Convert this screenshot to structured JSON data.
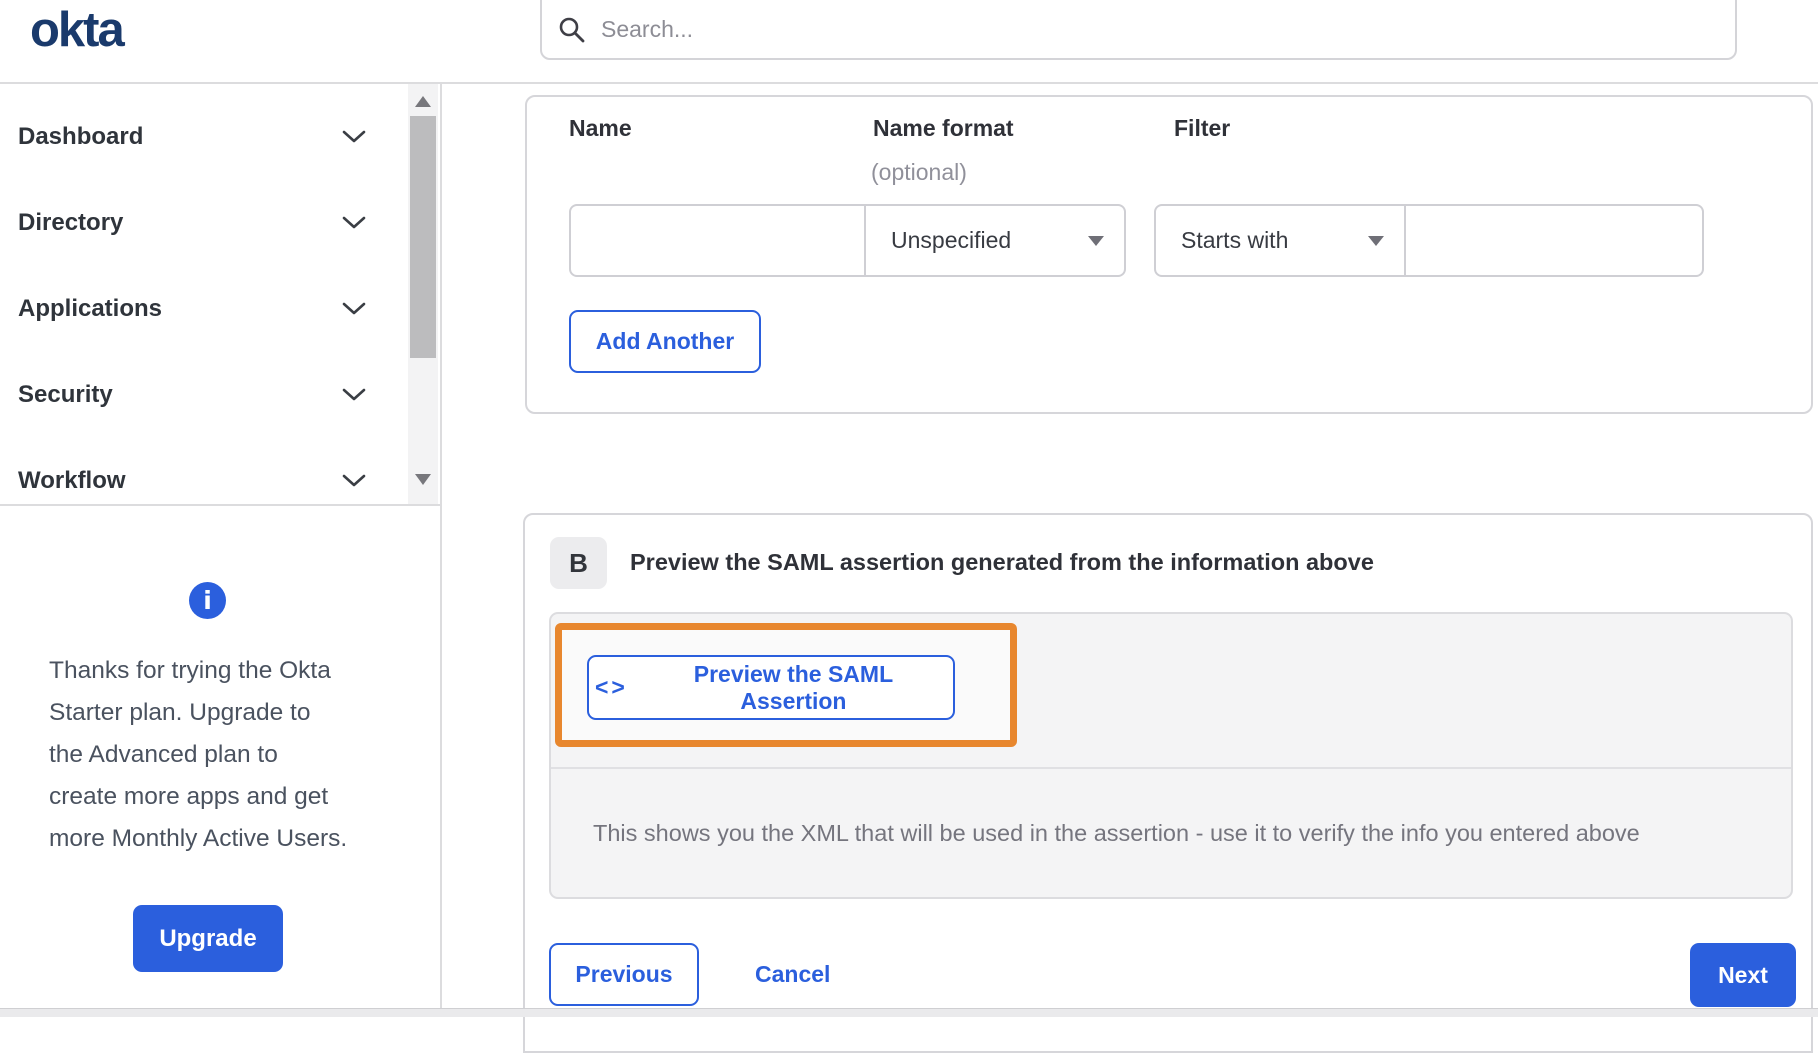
{
  "brand": {
    "logo_text": "okta"
  },
  "header": {
    "search_placeholder": "Search..."
  },
  "sidebar": {
    "items": [
      {
        "label": "Dashboard"
      },
      {
        "label": "Directory"
      },
      {
        "label": "Applications"
      },
      {
        "label": "Security"
      },
      {
        "label": "Workflow"
      }
    ]
  },
  "upgrade_panel": {
    "lines": [
      "Thanks for trying the Okta",
      "Starter plan. Upgrade to",
      "the Advanced plan to",
      "create more apps and get",
      "more Monthly Active Users."
    ],
    "button_label": "Upgrade"
  },
  "attribute_form": {
    "name_label": "Name",
    "name_format_label": "Name format",
    "name_format_sublabel": "(optional)",
    "filter_label": "Filter",
    "name_value": "",
    "name_format_value": "Unspecified",
    "filter_type_value": "Starts with",
    "filter_value": "",
    "add_another_label": "Add Another"
  },
  "preview_section": {
    "badge": "B",
    "heading": "Preview the SAML assertion generated from the information above",
    "button_icon": "<>",
    "button_label": "Preview the SAML Assertion",
    "description": "This shows you the XML that will be used in the assertion - use it to verify the info you entered above"
  },
  "wizard_footer": {
    "previous_label": "Previous",
    "cancel_label": "Cancel",
    "next_label": "Next"
  },
  "colors": {
    "accent_blue": "#2b5fdd",
    "logo_navy": "#1a3a6c",
    "highlight_orange": "#e8872e"
  }
}
